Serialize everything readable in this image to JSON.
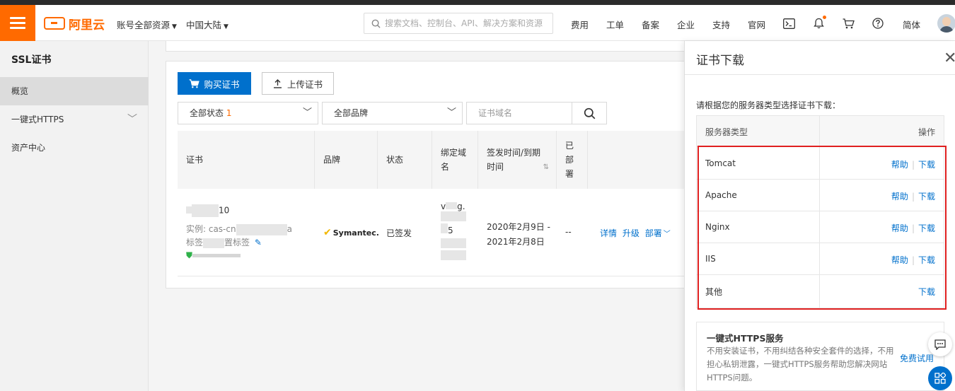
{
  "topbar": {
    "brand": "阿里云",
    "account_scope": "账号全部资源",
    "region": "中国大陆",
    "search_placeholder": "搜索文档、控制台、API、解决方案和资源",
    "links": [
      "费用",
      "工单",
      "备案",
      "企业",
      "支持",
      "官网"
    ],
    "language": "简体"
  },
  "sidebar": {
    "title": "SSL证书",
    "items": [
      {
        "label": "概览"
      },
      {
        "label": "一键式HTTPS"
      },
      {
        "label": "资产中心"
      }
    ]
  },
  "toolbar": {
    "buy_label": "购买证书",
    "upload_label": "上传证书"
  },
  "filters": {
    "status_label": "全部状态",
    "status_count": "1",
    "brand_label": "全部品牌",
    "domain_placeholder": "证书域名"
  },
  "table": {
    "headers": [
      "证书",
      "品牌",
      "状态",
      "绑定域名",
      "签发时间/到期时间",
      "已部署"
    ],
    "row": {
      "cert_name_suffix": "10",
      "instance_prefix": "实例: cas-cn",
      "instance_suffix": "a",
      "tag_prefix": "标签",
      "tag_suffix": "置标签",
      "brand": "Symantec.",
      "status": "已签发",
      "domain_fragment_1": "v",
      "domain_fragment_2": "g.",
      "domain_fragment_3": "5",
      "issue_date": "2020年2月9日 -",
      "expire_date": "2021年2月8日",
      "deployed": "--",
      "actions": [
        "详情",
        "升级",
        "部署"
      ]
    }
  },
  "drawer": {
    "title": "证书下载",
    "description": "请根据您的服务器类型选择证书下载：",
    "col_server": "服务器类型",
    "col_action": "操作",
    "servers": [
      {
        "name": "Tomcat",
        "help": "帮助",
        "download": "下载"
      },
      {
        "name": "Apache",
        "help": "帮助",
        "download": "下载"
      },
      {
        "name": "Nginx",
        "help": "帮助",
        "download": "下载"
      },
      {
        "name": "IIS",
        "help": "帮助",
        "download": "下载"
      },
      {
        "name": "其他",
        "help": "",
        "download": "下载"
      }
    ],
    "https_card": {
      "title": "一键式HTTPS服务",
      "description": "不用安装证书，不用纠结各种安全套件的选择，不用担心私钥泄露，一键式HTTPS服务帮助您解决网站HTTPS问题。",
      "link": "免费试用"
    }
  },
  "colors": {
    "brand_orange": "#ff6a00",
    "primary_blue": "#0070cc",
    "highlight_red": "#e02020"
  }
}
